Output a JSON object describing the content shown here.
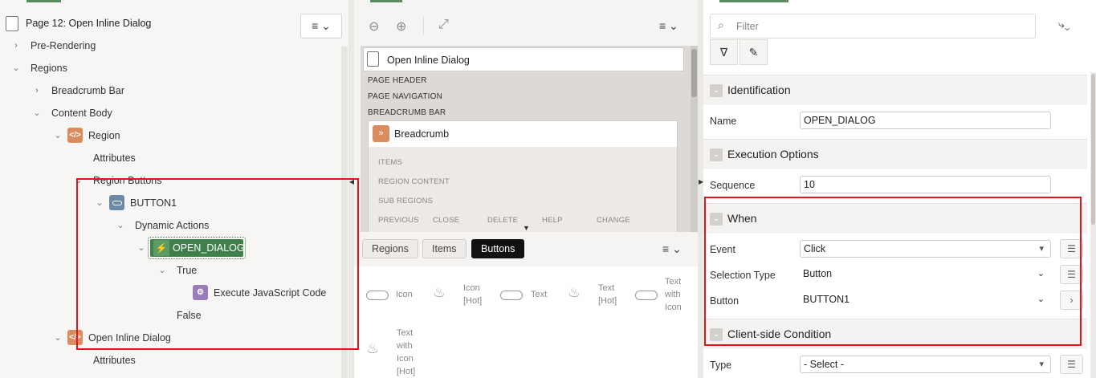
{
  "left": {
    "page_title": "Page 12: Open Inline Dialog",
    "tree": {
      "pre_rendering": "Pre-Rendering",
      "regions": "Regions",
      "breadcrumb_bar": "Breadcrumb Bar",
      "content_body": "Content Body",
      "region": "Region",
      "attributes": "Attributes",
      "region_buttons": "Region Buttons",
      "button1": "BUTTON1",
      "dynamic_actions": "Dynamic Actions",
      "open_dialog": "OPEN_DIALOG",
      "true_label": "True",
      "execute_js": "Execute JavaScript Code",
      "false_label": "False",
      "open_inline_dialog": "Open Inline Dialog",
      "attributes2": "Attributes"
    }
  },
  "mid": {
    "page_region_title": "Open Inline Dialog",
    "layout": {
      "page_header": "PAGE HEADER",
      "page_navigation": "PAGE NAVIGATION",
      "breadcrumb_bar": "BREADCRUMB BAR",
      "breadcrumb": "Breadcrumb",
      "items": "ITEMS",
      "region_content": "REGION CONTENT",
      "sub_regions": "SUB REGIONS",
      "positions": [
        "PREVIOUS",
        "CLOSE",
        "DELETE",
        "HELP",
        "CHANGE"
      ]
    },
    "gallery": {
      "tabs": [
        "Regions",
        "Items",
        "Buttons"
      ],
      "active_tab": "Buttons",
      "items": [
        {
          "label": "Icon",
          "icon": "pill-icon"
        },
        {
          "label": "Icon\n[Hot]",
          "icon": "flame-icon"
        },
        {
          "label": "Text",
          "icon": "pill-icon"
        },
        {
          "label": "Text\n[Hot]",
          "icon": "flame-icon"
        },
        {
          "label": "Text\nwith\nIcon",
          "icon": "pill-icon"
        },
        {
          "label": "Text\nwith\nIcon\n[Hot]",
          "icon": "flame-icon"
        }
      ]
    }
  },
  "right": {
    "filter_placeholder": "Filter",
    "sections": {
      "identification": "Identification",
      "execution_options": "Execution Options",
      "when": "When",
      "client_side_condition": "Client-side Condition"
    },
    "props": {
      "name_label": "Name",
      "name_value": "OPEN_DIALOG",
      "sequence_label": "Sequence",
      "sequence_value": "10",
      "event_label": "Event",
      "event_value": "Click",
      "selection_type_label": "Selection Type",
      "selection_type_value": "Button",
      "button_label": "Button",
      "button_value": "BUTTON1",
      "type_label": "Type",
      "type_value": "- Select -"
    }
  },
  "colors": {
    "accent_green": "#3f7f4a",
    "highlight_red": "#e3151b",
    "region_icon": "#d98c5f",
    "button_icon": "#6a8aa8",
    "action_icon": "#9a7cb8"
  }
}
